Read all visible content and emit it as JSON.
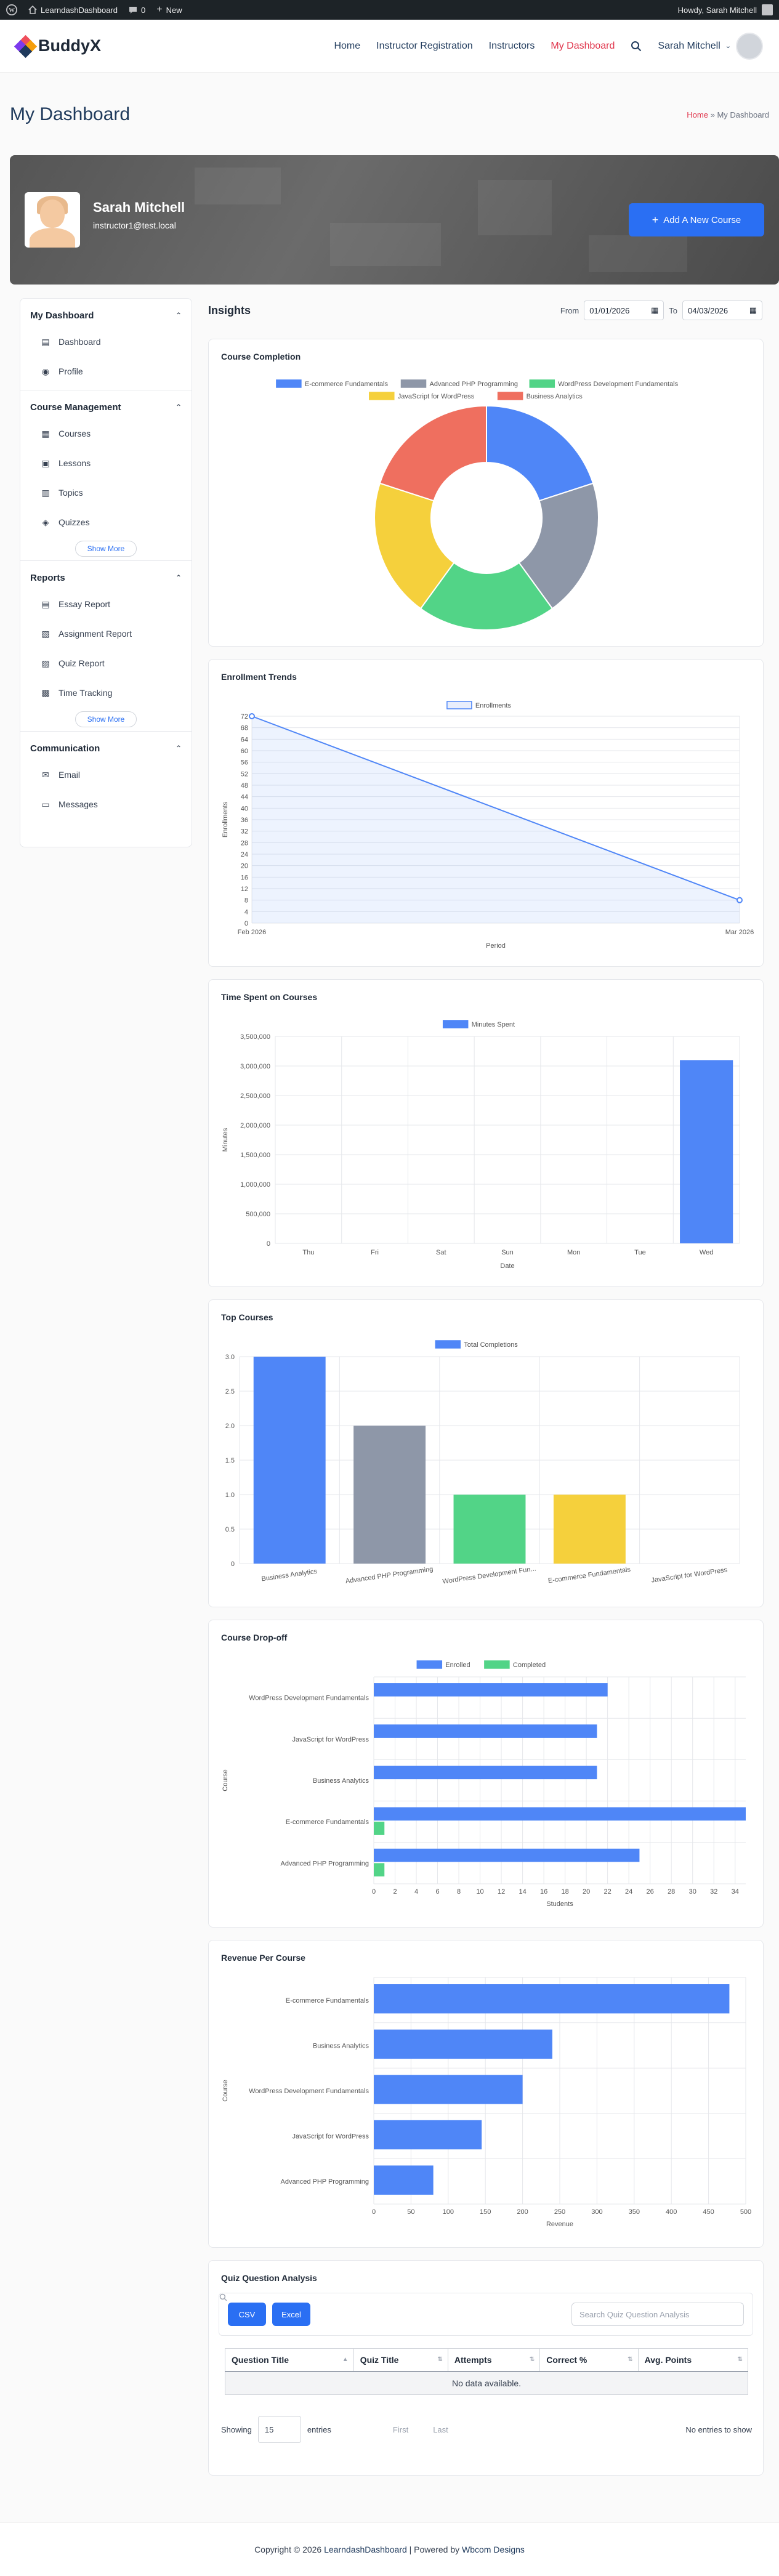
{
  "adminbar": {
    "site_name": "LearndashDashboard",
    "comments_count": "0",
    "new_label": "New",
    "howdy": "Howdy, Sarah Mitchell"
  },
  "header": {
    "logo": "BuddyX",
    "nav": [
      "Home",
      "Instructor Registration",
      "Instructors",
      "My Dashboard"
    ],
    "user_name": "Sarah Mitchell"
  },
  "page": {
    "title": "My Dashboard",
    "crumb_home": "Home",
    "crumb_sep": "»",
    "crumb_current": "My Dashboard"
  },
  "profile": {
    "name": "Sarah Mitchell",
    "email": "instructor1@test.local",
    "add_course": "Add A New Course"
  },
  "sidebar": {
    "sections": [
      {
        "title": "My Dashboard",
        "items": [
          {
            "label": "Dashboard",
            "icon": "dashboard-icon"
          },
          {
            "label": "Profile",
            "icon": "profile-icon"
          }
        ]
      },
      {
        "title": "Course Management",
        "items": [
          {
            "label": "Courses",
            "icon": "courses-icon"
          },
          {
            "label": "Lessons",
            "icon": "lessons-icon"
          },
          {
            "label": "Topics",
            "icon": "topics-icon"
          },
          {
            "label": "Quizzes",
            "icon": "quizzes-icon"
          }
        ],
        "show_more": "Show More"
      },
      {
        "title": "Reports",
        "items": [
          {
            "label": "Essay Report",
            "icon": "essay-icon"
          },
          {
            "label": "Assignment Report",
            "icon": "assignment-icon"
          },
          {
            "label": "Quiz Report",
            "icon": "quiz-report-icon"
          },
          {
            "label": "Time Tracking",
            "icon": "time-icon"
          }
        ],
        "show_more": "Show More"
      },
      {
        "title": "Communication",
        "items": [
          {
            "label": "Email",
            "icon": "email-icon"
          },
          {
            "label": "Messages",
            "icon": "messages-icon"
          }
        ]
      }
    ]
  },
  "insights": {
    "title": "Insights",
    "from_label": "From",
    "from_value": "01/01/2026",
    "to_label": "To",
    "to_value": "04/03/2026"
  },
  "colors": {
    "blue": "#4f86f7",
    "gray": "#8e97a8",
    "green": "#52d487",
    "yellow": "#f5d03c",
    "red": "#ef6f5f",
    "primary": "#2a6ff3",
    "accent_red": "#e0344b"
  },
  "chart_data": [
    {
      "type": "pie",
      "title": "Course Completion",
      "categories": [
        "E-commerce Fundamentals",
        "Advanced PHP Programming",
        "WordPress Development Fundamentals",
        "JavaScript for WordPress",
        "Business Analytics"
      ],
      "values": [
        1,
        1,
        1,
        1,
        1
      ],
      "colors": [
        "#4f86f7",
        "#8e97a8",
        "#52d487",
        "#f5d03c",
        "#ef6f5f"
      ],
      "legend": "top"
    },
    {
      "type": "line",
      "title": "Enrollment Trends",
      "x": [
        "Feb 2026",
        "Mar 2026"
      ],
      "series": [
        {
          "name": "Enrollments",
          "values": [
            72,
            8
          ]
        }
      ],
      "xlabel": "Period",
      "ylabel": "Enrollments",
      "ylim": [
        0,
        72
      ],
      "yticks": [
        0,
        4,
        8,
        12,
        16,
        20,
        24,
        28,
        32,
        36,
        40,
        44,
        48,
        52,
        56,
        60,
        64,
        68,
        72
      ],
      "grid": true,
      "legend": "top"
    },
    {
      "type": "bar",
      "title": "Time Spent on Courses",
      "categories": [
        "Thu",
        "Fri",
        "Sat",
        "Sun",
        "Mon",
        "Tue",
        "Wed"
      ],
      "series": [
        {
          "name": "Minutes Spent",
          "values": [
            0,
            0,
            0,
            0,
            0,
            0,
            3100000
          ]
        }
      ],
      "xlabel": "Date",
      "ylabel": "Minutes",
      "ylim": [
        0,
        3500000
      ],
      "yticks": [
        0,
        500000,
        1000000,
        1500000,
        2000000,
        2500000,
        3000000,
        3500000
      ],
      "ytick_labels": [
        "0",
        "500,000",
        "1,000,000",
        "1,500,000",
        "2,000,000",
        "2,500,000",
        "3,000,000",
        "3,500,000"
      ],
      "grid": true,
      "legend": "top"
    },
    {
      "type": "bar",
      "title": "Top Courses",
      "categories": [
        "Business Analytics",
        "Advanced PHP Programming",
        "WordPress Development Fun...",
        "E-commerce Fundamentals",
        "JavaScript for WordPress"
      ],
      "series": [
        {
          "name": "Total Completions",
          "values": [
            3,
            2,
            1,
            1,
            0
          ]
        }
      ],
      "bar_colors": [
        "#4f86f7",
        "#8e97a8",
        "#52d487",
        "#f5d03c",
        "#ef6f5f"
      ],
      "ylim": [
        0,
        3
      ],
      "yticks": [
        0,
        0.5,
        1.0,
        1.5,
        2.0,
        2.5,
        3.0
      ],
      "ytick_labels": [
        "0",
        "0.5",
        "1.0",
        "1.5",
        "2.0",
        "2.5",
        "3.0"
      ],
      "grid": true,
      "legend": "top"
    },
    {
      "type": "bar",
      "orientation": "horizontal",
      "title": "Course Drop-off",
      "categories": [
        "WordPress Development Fundamentals",
        "JavaScript for WordPress",
        "Business Analytics",
        "E-commerce Fundamentals",
        "Advanced PHP Programming"
      ],
      "series": [
        {
          "name": "Enrolled",
          "values": [
            22,
            21,
            21,
            35,
            25
          ],
          "color": "#4f86f7"
        },
        {
          "name": "Completed",
          "values": [
            0,
            0,
            0,
            1,
            1
          ],
          "color": "#52d487"
        }
      ],
      "xlabel": "Students",
      "ylabel": "Course",
      "xlim": [
        0,
        35
      ],
      "xticks": [
        0,
        2,
        4,
        6,
        8,
        10,
        12,
        14,
        16,
        18,
        20,
        22,
        24,
        26,
        28,
        30,
        32,
        34
      ],
      "grid": true,
      "legend": "top"
    },
    {
      "type": "bar",
      "orientation": "horizontal",
      "title": "Revenue Per Course",
      "categories": [
        "E-commerce Fundamentals",
        "Business Analytics",
        "WordPress Development Fundamentals",
        "JavaScript for WordPress",
        "Advanced PHP Programming"
      ],
      "series": [
        {
          "values": [
            478,
            240,
            200,
            145,
            80
          ],
          "color": "#4f86f7"
        }
      ],
      "xlabel": "Revenue",
      "ylabel": "Course",
      "xlim": [
        0,
        500
      ],
      "xticks": [
        0,
        50,
        100,
        150,
        200,
        250,
        300,
        350,
        400,
        450,
        500
      ],
      "grid": true
    }
  ],
  "quiz_analysis": {
    "title": "Quiz Question Analysis",
    "csv": "CSV",
    "excel": "Excel",
    "search_placeholder": "Search Quiz Question Analysis",
    "columns": [
      "Question Title",
      "Quiz Title",
      "Attempts",
      "Correct %",
      "Avg. Points"
    ],
    "empty": "No data available.",
    "showing": "Showing",
    "page_length": "15",
    "entries": "entries",
    "first": "First",
    "last": "Last",
    "no_entries": "No entries to show"
  },
  "footer": {
    "copyright": "Copyright © 2026",
    "site_link": "LearndashDashboard",
    "powered": "| Powered by",
    "company": "Wbcom Designs"
  }
}
